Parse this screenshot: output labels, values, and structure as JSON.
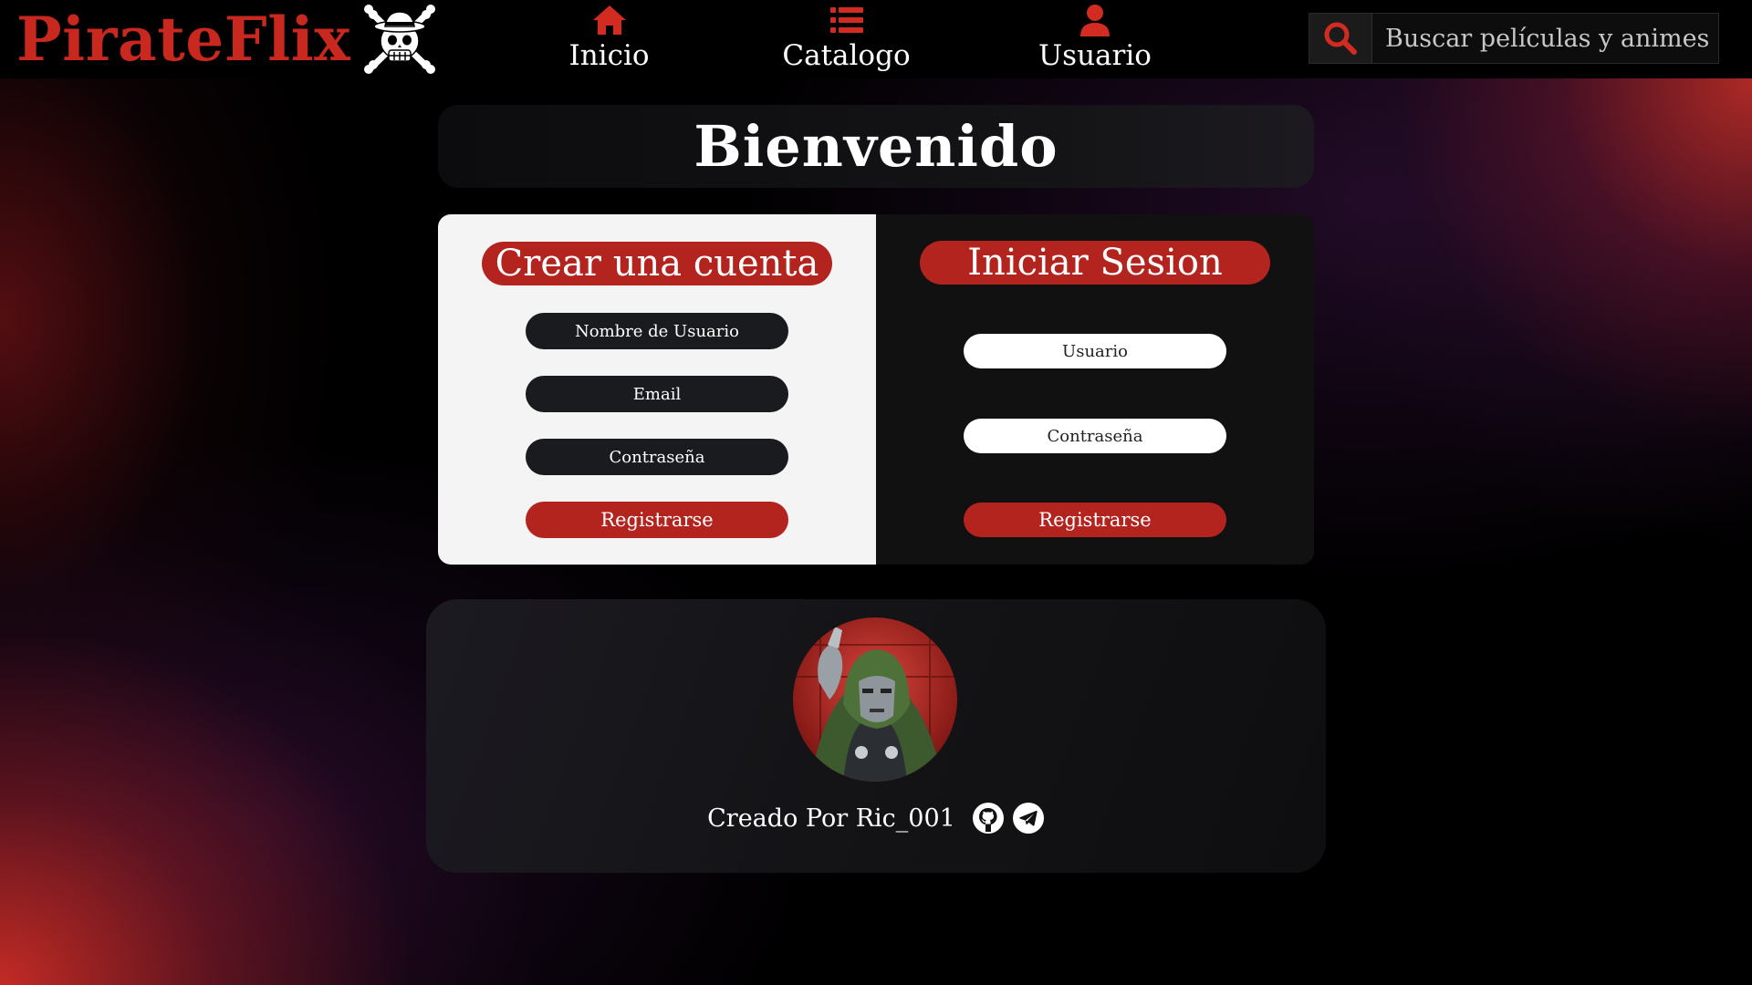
{
  "brand": {
    "name": "PirateFlix",
    "accent_color": "#c9281f",
    "logo_icon": "straw-hat-jolly-roger-icon"
  },
  "nav": {
    "items": [
      {
        "label": "Inicio",
        "icon": "home-icon"
      },
      {
        "label": "Catalogo",
        "icon": "list-icon"
      },
      {
        "label": "Usuario",
        "icon": "user-icon"
      }
    ]
  },
  "search": {
    "placeholder": "Buscar películas y animes",
    "icon": "search-icon"
  },
  "welcome": {
    "title": "Bienvenido"
  },
  "register": {
    "title": "Crear una cuenta",
    "username_placeholder": "Nombre de Usuario",
    "email_placeholder": "Email",
    "password_placeholder": "Contraseña",
    "submit_label": "Registrarse"
  },
  "login": {
    "title": "Iniciar Sesion",
    "username_placeholder": "Usuario",
    "password_placeholder": "Contraseña",
    "submit_label": "Registrarse"
  },
  "credits": {
    "text": "Creado Por Ric_001",
    "avatar": "author-avatar",
    "social": [
      {
        "icon": "github-icon"
      },
      {
        "icon": "telegram-icon"
      }
    ]
  },
  "colors": {
    "primary_red": "#b3241f",
    "panel_light": "#f4f4f4",
    "panel_dark": "#111111",
    "field_dark": "#1a1b1e"
  }
}
